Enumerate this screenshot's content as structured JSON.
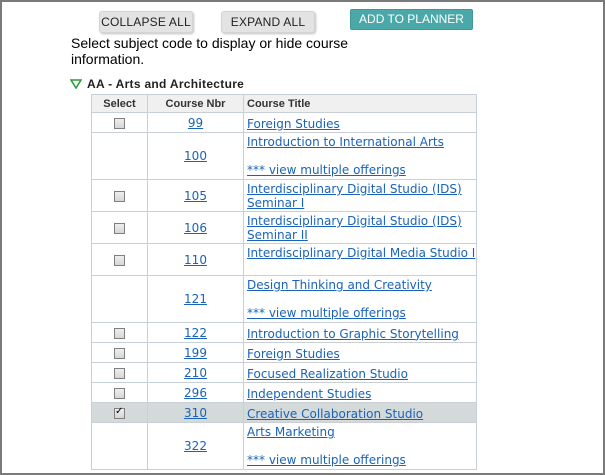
{
  "toolbar": {
    "collapse_label": "COLLAPSE ALL",
    "expand_label": "EXPAND ALL",
    "planner_label": "ADD TO PLANNER"
  },
  "instructions": "Select subject code to display or hide course information.",
  "subject": {
    "label": "AA - Arts and Architecture",
    "expanded": true,
    "icon": "triangle-down-icon"
  },
  "table": {
    "headers": {
      "select": "Select",
      "nbr": "Course Nbr",
      "title": "Course Title"
    },
    "rows": [
      {
        "nbr": "99",
        "title": "Foreign Studies",
        "type": "single",
        "checkbox": true,
        "checked": false,
        "highlight": false
      },
      {
        "nbr": "100",
        "title": "Introduction to International Arts",
        "type": "multi",
        "view": "*** view multiple offerings",
        "checkbox": false,
        "checked": false,
        "highlight": false
      },
      {
        "nbr": "105",
        "title": "Interdisciplinary Digital Studio (IDS) Seminar I",
        "type": "double",
        "checkbox": true,
        "checked": false,
        "highlight": false
      },
      {
        "nbr": "106",
        "title": "Interdisciplinary Digital Studio (IDS) Seminar II",
        "type": "double",
        "checkbox": true,
        "checked": false,
        "highlight": false
      },
      {
        "nbr": "110",
        "title": "Interdisciplinary Digital Media Studio I",
        "type": "double",
        "checkbox": true,
        "checked": false,
        "highlight": false
      },
      {
        "nbr": "121",
        "title": "Design Thinking and Creativity",
        "type": "multi",
        "view": "*** view multiple offerings",
        "checkbox": false,
        "checked": false,
        "highlight": false
      },
      {
        "nbr": "122",
        "title": "Introduction to Graphic Storytelling",
        "type": "single",
        "checkbox": true,
        "checked": false,
        "highlight": false
      },
      {
        "nbr": "199",
        "title": "Foreign Studies",
        "type": "single",
        "checkbox": true,
        "checked": false,
        "highlight": false
      },
      {
        "nbr": "210",
        "title": "Focused Realization Studio",
        "type": "single",
        "checkbox": true,
        "checked": false,
        "highlight": false
      },
      {
        "nbr": "296",
        "title": "Independent Studies",
        "type": "single",
        "checkbox": true,
        "checked": false,
        "highlight": false
      },
      {
        "nbr": "310",
        "title": "Creative Collaboration Studio",
        "type": "single",
        "checkbox": true,
        "checked": true,
        "highlight": true
      },
      {
        "nbr": "322",
        "title": "Arts Marketing",
        "type": "multi",
        "view": "*** view multiple offerings",
        "checkbox": false,
        "checked": false,
        "highlight": false
      }
    ]
  },
  "colors": {
    "link": "#1a63b8",
    "planner_button": "#4aa8a8",
    "highlight_row": "#d4d9d9",
    "triangle": "#2e9a3a"
  }
}
